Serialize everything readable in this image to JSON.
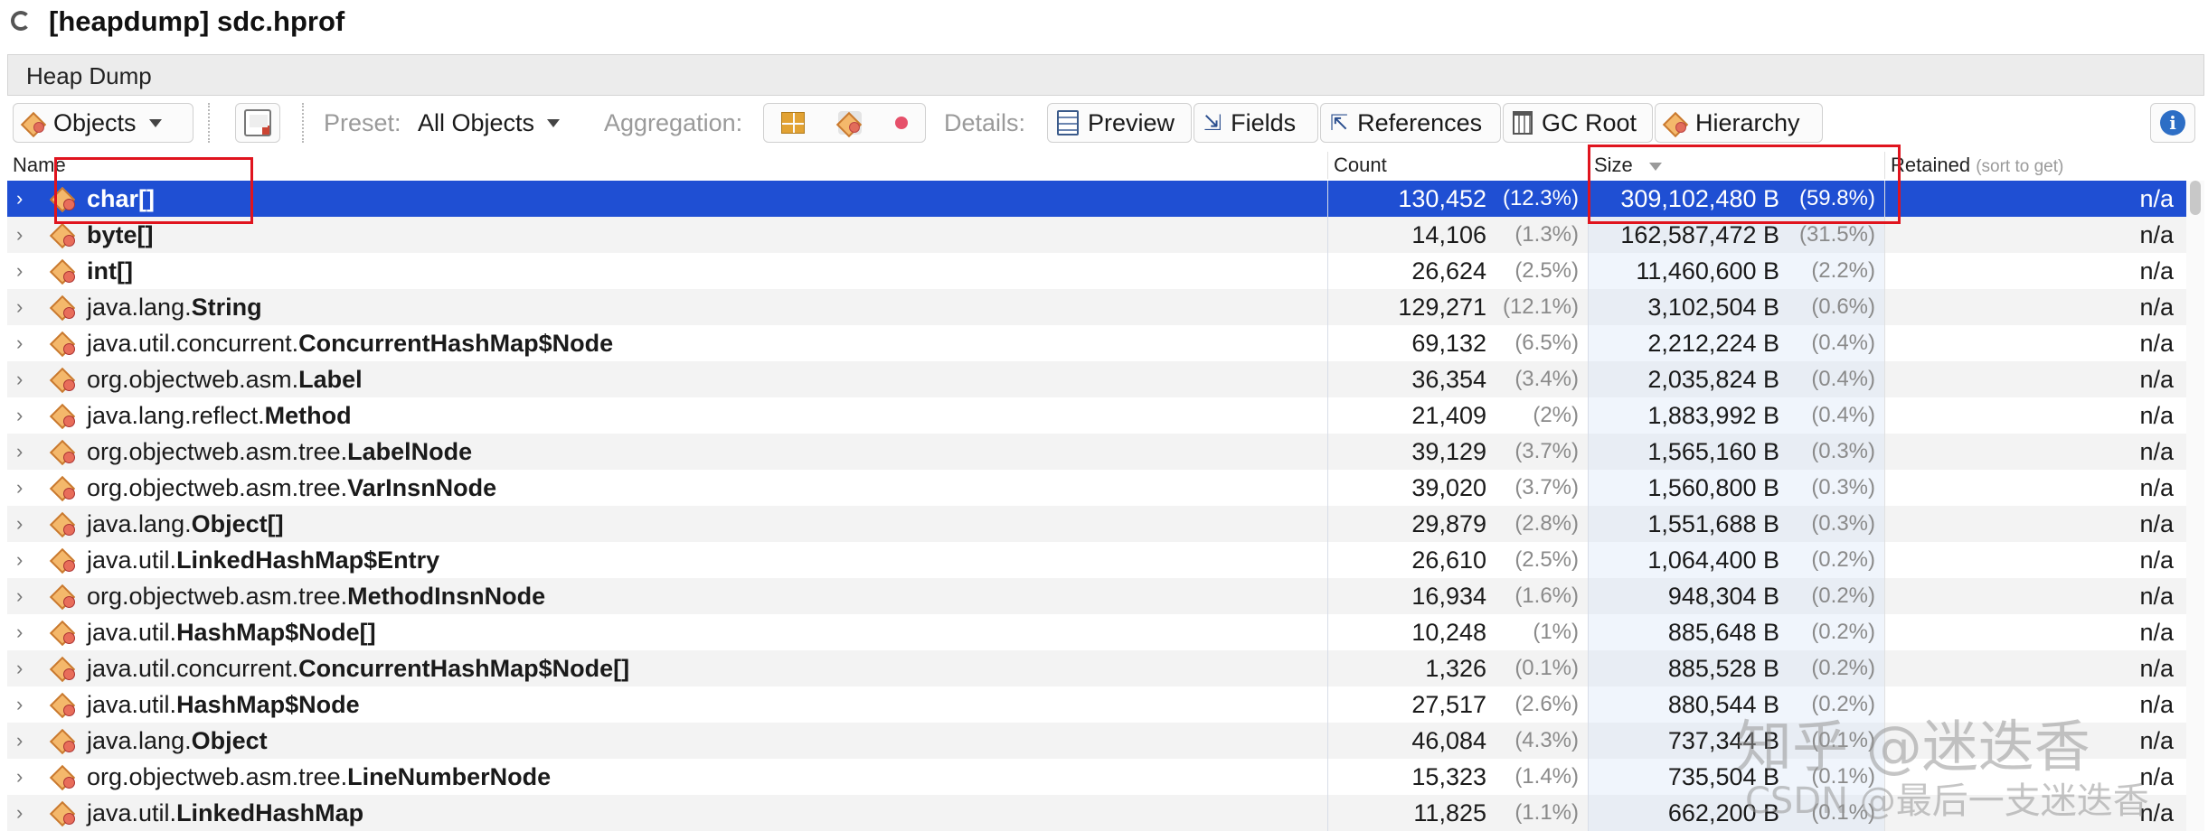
{
  "window": {
    "title": "[heapdump] sdc.hprof"
  },
  "tab": {
    "label": "Heap Dump"
  },
  "toolbar": {
    "view_select": "Objects",
    "preset_label": "Preset:",
    "preset_value": "All Objects",
    "aggregation_label": "Aggregation:",
    "details_label": "Details:",
    "details_buttons": [
      "Preview",
      "Fields",
      "References",
      "GC Root",
      "Hierarchy"
    ]
  },
  "table": {
    "columns": {
      "name": "Name",
      "count": "Count",
      "size": "Size",
      "retained": "Retained",
      "retained_hint": "(sort to get)"
    },
    "sorted_by": "size",
    "selected_row": 0,
    "rows": [
      {
        "pkg": "",
        "cls": "char[]",
        "count": "130,452",
        "count_pct": "(12.3%)",
        "size": "309,102,480 B",
        "size_pct": "(59.8%)",
        "retained": "n/a"
      },
      {
        "pkg": "",
        "cls": "byte[]",
        "count": "14,106",
        "count_pct": "(1.3%)",
        "size": "162,587,472 B",
        "size_pct": "(31.5%)",
        "retained": "n/a"
      },
      {
        "pkg": "",
        "cls": "int[]",
        "count": "26,624",
        "count_pct": "(2.5%)",
        "size": "11,460,600 B",
        "size_pct": "(2.2%)",
        "retained": "n/a"
      },
      {
        "pkg": "java.lang.",
        "cls": "String",
        "count": "129,271",
        "count_pct": "(12.1%)",
        "size": "3,102,504 B",
        "size_pct": "(0.6%)",
        "retained": "n/a"
      },
      {
        "pkg": "java.util.concurrent.",
        "cls": "ConcurrentHashMap$Node",
        "count": "69,132",
        "count_pct": "(6.5%)",
        "size": "2,212,224 B",
        "size_pct": "(0.4%)",
        "retained": "n/a"
      },
      {
        "pkg": "org.objectweb.asm.",
        "cls": "Label",
        "count": "36,354",
        "count_pct": "(3.4%)",
        "size": "2,035,824 B",
        "size_pct": "(0.4%)",
        "retained": "n/a"
      },
      {
        "pkg": "java.lang.reflect.",
        "cls": "Method",
        "count": "21,409",
        "count_pct": "(2%)",
        "size": "1,883,992 B",
        "size_pct": "(0.4%)",
        "retained": "n/a"
      },
      {
        "pkg": "org.objectweb.asm.tree.",
        "cls": "LabelNode",
        "count": "39,129",
        "count_pct": "(3.7%)",
        "size": "1,565,160 B",
        "size_pct": "(0.3%)",
        "retained": "n/a"
      },
      {
        "pkg": "org.objectweb.asm.tree.",
        "cls": "VarInsnNode",
        "count": "39,020",
        "count_pct": "(3.7%)",
        "size": "1,560,800 B",
        "size_pct": "(0.3%)",
        "retained": "n/a"
      },
      {
        "pkg": "java.lang.",
        "cls": "Object[]",
        "count": "29,879",
        "count_pct": "(2.8%)",
        "size": "1,551,688 B",
        "size_pct": "(0.3%)",
        "retained": "n/a"
      },
      {
        "pkg": "java.util.",
        "cls": "LinkedHashMap$Entry",
        "count": "26,610",
        "count_pct": "(2.5%)",
        "size": "1,064,400 B",
        "size_pct": "(0.2%)",
        "retained": "n/a"
      },
      {
        "pkg": "org.objectweb.asm.tree.",
        "cls": "MethodInsnNode",
        "count": "16,934",
        "count_pct": "(1.6%)",
        "size": "948,304 B",
        "size_pct": "(0.2%)",
        "retained": "n/a"
      },
      {
        "pkg": "java.util.",
        "cls": "HashMap$Node[]",
        "count": "10,248",
        "count_pct": "(1%)",
        "size": "885,648 B",
        "size_pct": "(0.2%)",
        "retained": "n/a"
      },
      {
        "pkg": "java.util.concurrent.",
        "cls": "ConcurrentHashMap$Node[]",
        "count": "1,326",
        "count_pct": "(0.1%)",
        "size": "885,528 B",
        "size_pct": "(0.2%)",
        "retained": "n/a"
      },
      {
        "pkg": "java.util.",
        "cls": "HashMap$Node",
        "count": "27,517",
        "count_pct": "(2.6%)",
        "size": "880,544 B",
        "size_pct": "(0.2%)",
        "retained": "n/a"
      },
      {
        "pkg": "java.lang.",
        "cls": "Object",
        "count": "46,084",
        "count_pct": "(4.3%)",
        "size": "737,344 B",
        "size_pct": "(0.1%)",
        "retained": "n/a"
      },
      {
        "pkg": "org.objectweb.asm.tree.",
        "cls": "LineNumberNode",
        "count": "15,323",
        "count_pct": "(1.4%)",
        "size": "735,504 B",
        "size_pct": "(0.1%)",
        "retained": "n/a"
      },
      {
        "pkg": "java.util.",
        "cls": "LinkedHashMap",
        "count": "11,825",
        "count_pct": "(1.1%)",
        "size": "662,200 B",
        "size_pct": "(0.1%)",
        "retained": "n/a"
      }
    ]
  },
  "watermark": {
    "line1": "知乎 @迷迭香",
    "line2": "CSDN @最后一支迷迭香"
  },
  "colors": {
    "selection": "#1f4fd3",
    "highlight_box": "#e0141e",
    "alt_row": "#f3f3f3"
  }
}
